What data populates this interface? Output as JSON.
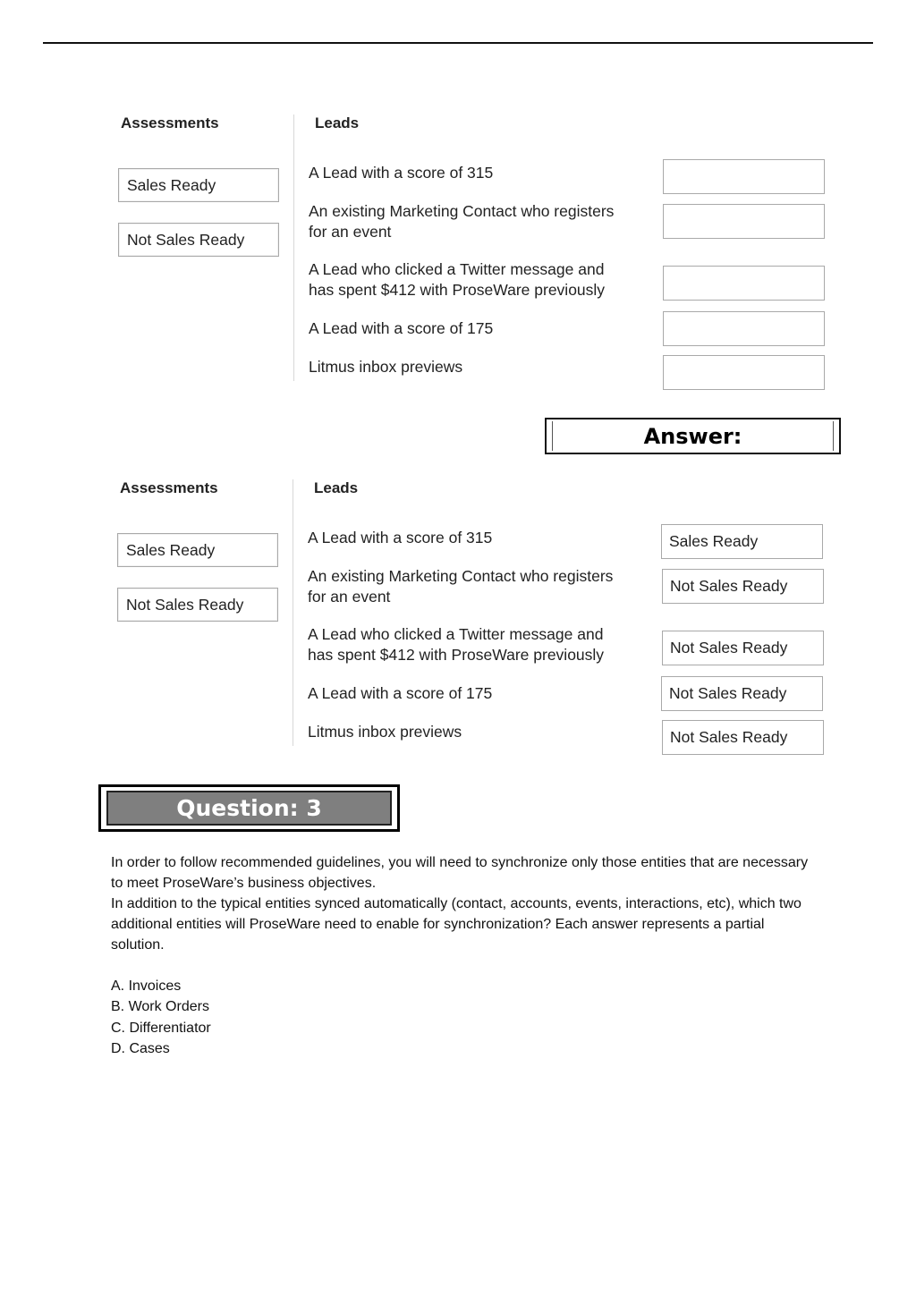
{
  "exhibit_question": {
    "assessments_header": "Assessments",
    "leads_header": "Leads",
    "assessments": [
      "Sales Ready",
      "Not Sales Ready"
    ],
    "leads": [
      {
        "line1": "A Lead with a score of 315",
        "line2": "",
        "slot": ""
      },
      {
        "line1": "An existing Marketing Contact who registers",
        "line2": "for an event",
        "slot": ""
      },
      {
        "line1": "A Lead who clicked a Twitter message and",
        "line2": "has spent $412 with ProseWare previously",
        "slot": ""
      },
      {
        "line1": "A Lead with a score of 175",
        "line2": "",
        "slot": ""
      },
      {
        "line1": "Litmus inbox previews",
        "line2": "",
        "slot": ""
      }
    ]
  },
  "answer_banner": "Answer:",
  "exhibit_answer": {
    "assessments_header": "Assessments",
    "leads_header": "Leads",
    "assessments": [
      "Sales Ready",
      "Not Sales Ready"
    ],
    "leads": [
      {
        "line1": "A Lead with a score of 315",
        "line2": "",
        "slot": "Sales Ready"
      },
      {
        "line1": "An existing Marketing Contact who registers",
        "line2": "for an event",
        "slot": "Not Sales Ready"
      },
      {
        "line1": "A Lead who clicked a Twitter message and",
        "line2": "has spent $412 with ProseWare previously",
        "slot": "Not Sales Ready"
      },
      {
        "line1": "A Lead with a score of 175",
        "line2": "",
        "slot": "Not Sales Ready"
      },
      {
        "line1": "Litmus inbox previews",
        "line2": "",
        "slot": "Not Sales Ready"
      }
    ]
  },
  "question": {
    "banner": "Question: 3",
    "paragraphs": [
      "In order to follow recommended guidelines, you will need to synchronize only those entities that are necessary to meet ProseWare’s business objectives.",
      "In addition to the typical entities synced automatically (contact, accounts, events, interactions, etc), which two additional entities will ProseWare need to enable for synchronization? Each answer represents a partial solution."
    ],
    "options": [
      "A. Invoices",
      "B. Work Orders",
      "C. Differentiator",
      "D. Cases"
    ]
  }
}
